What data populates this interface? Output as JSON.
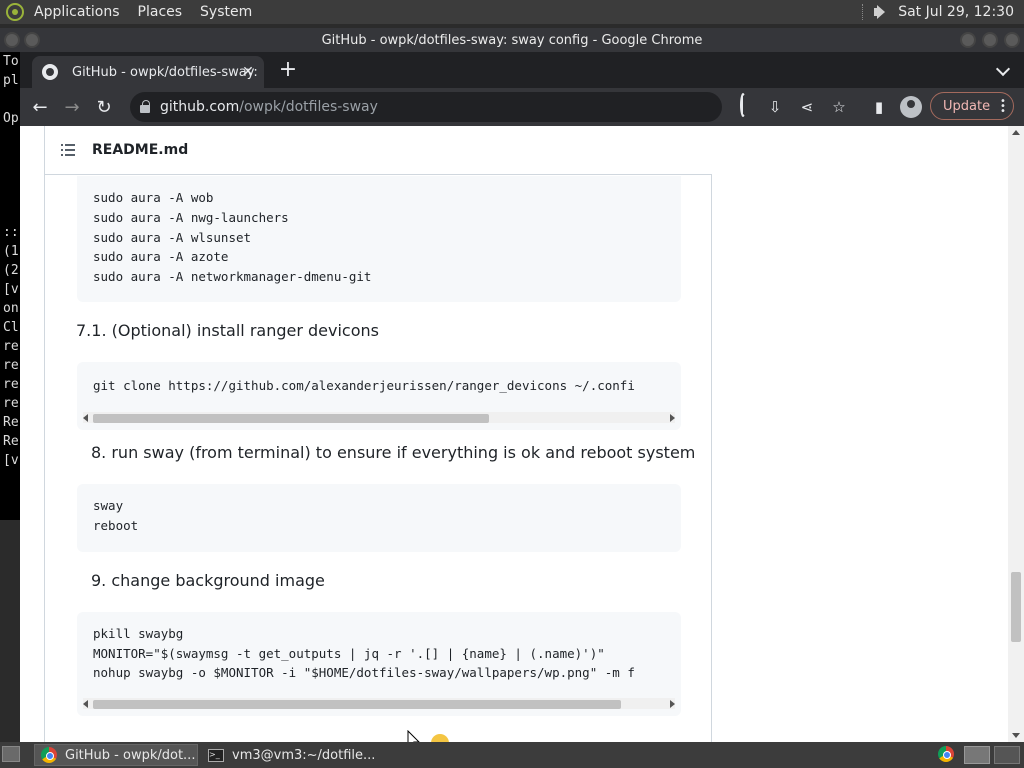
{
  "panel": {
    "menus": [
      "Applications",
      "Places",
      "System"
    ],
    "clock": "Sat Jul 29, 12:30"
  },
  "background_terminal": {
    "lines": [
      "To",
      "pl",
      "",
      "Op",
      "",
      "",
      "",
      "",
      "",
      "::",
      "(1",
      "(2",
      "[v",
      "on",
      "Cl",
      "re",
      "re",
      "re",
      "re",
      "Re",
      "Re",
      "[v"
    ]
  },
  "window": {
    "title": "GitHub - owpk/dotfiles-sway: sway config - Google Chrome"
  },
  "browser": {
    "tab_title": "GitHub - owpk/dotfiles-sway:",
    "url_host": "github.com",
    "url_path": "/owpk/dotfiles-sway",
    "update_label": "Update"
  },
  "readme": {
    "file_name": "README.md",
    "block1": [
      "sudo aura -A wob",
      "sudo aura -A nwg-launchers",
      "sudo aura -A wlsunset",
      "sudo aura -A azote",
      "sudo aura -A networkmanager-dmenu-git"
    ],
    "heading_7_1": "7.1. (Optional) install ranger devicons",
    "block2": [
      "git clone https://github.com/alexanderjeurissen/ranger_devicons ~/.confi"
    ],
    "heading_8": "8. run sway (from terminal) to ensure if everything is ok and reboot system",
    "block3": [
      "sway",
      "reboot"
    ],
    "heading_9": "9. change background image",
    "block4": [
      "pkill swaybg",
      "MONITOR=\"$(swaymsg -t get_outputs | jq -r '.[] | {name} | (.name)')\"",
      "nohup swaybg -o $MONITOR -i \"$HOME/dotfiles-sway/wallpapers/wp.png\" -m f"
    ]
  },
  "taskbar": {
    "items": [
      "GitHub - owpk/dot...",
      "vm3@vm3:~/dotfile..."
    ]
  }
}
